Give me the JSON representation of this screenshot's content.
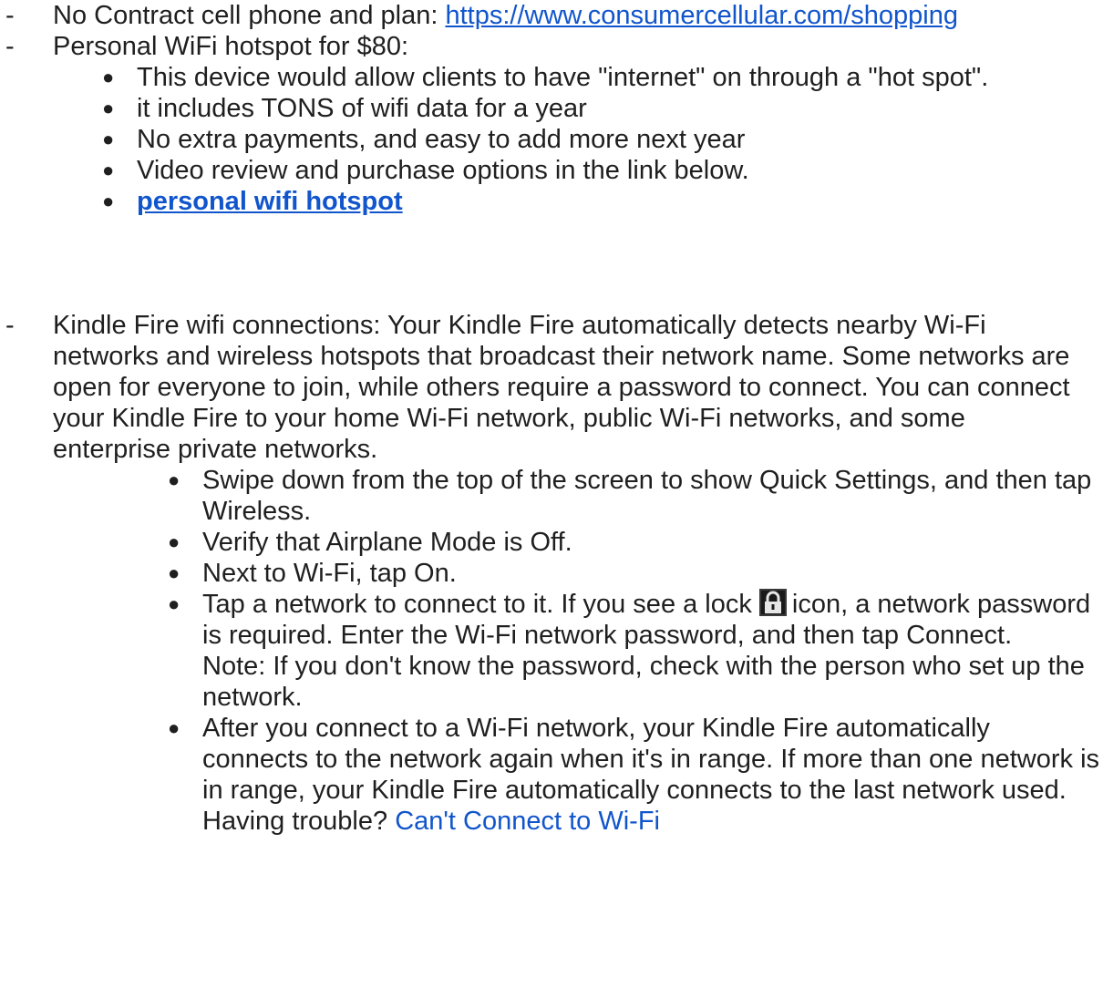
{
  "items": [
    {
      "dash": "-",
      "text": "No Contract cell phone and plan: ",
      "link": "https://www.consumercellular.com/shopping"
    },
    {
      "dash": "-",
      "text": "Personal WiFi hotspot for $80:",
      "bullets": [
        "This device would allow clients to have \"internet\" on through a \"hot spot\".",
        "it includes TONS of wifi data for a year",
        "No extra payments, and easy to add more next year",
        "Video review and purchase options in the link below."
      ],
      "bullet_link": "personal wifi hotspot"
    },
    {
      "dash": "-",
      "text": "Kindle Fire wifi connections: Your Kindle Fire automatically detects nearby Wi-Fi networks and wireless hotspots that broadcast their network name. Some networks are open for everyone to join, while others require a password to connect. You can connect your Kindle Fire to your home Wi-Fi network, public Wi-Fi networks, and some enterprise private networks.",
      "bullets": [
        "Swipe down from the top of the screen to show Quick Settings, and then tap Wireless.",
        "Verify that Airplane Mode is Off.",
        "Next to Wi-Fi, tap On."
      ],
      "lock_bullet": {
        "before": "Tap a network to connect to it. If you see a lock",
        "after": "icon, a network password is required. Enter the Wi-Fi network password, and then tap Connect.",
        "note": "Note: If you don't know the password, check with the person who set up the network."
      },
      "last_bullet": {
        "text": "After you connect to a Wi-Fi network, your Kindle Fire automatically connects to the network again when it's in range. If more than one network is in range, your Kindle Fire automatically connects to the last network used. Having trouble? ",
        "link": "Can't Connect to Wi-Fi"
      }
    }
  ],
  "bullet_glyph": "●",
  "icons": {
    "lock": "lock-icon"
  },
  "colors": {
    "link": "#1155cc",
    "text": "#1f1f1f"
  }
}
